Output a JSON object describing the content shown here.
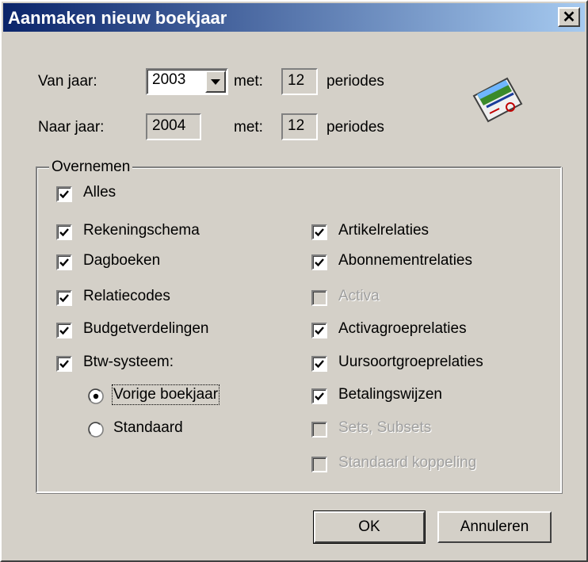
{
  "window": {
    "title": "Aanmaken nieuw boekjaar",
    "close_glyph": "✕"
  },
  "from": {
    "label": "Van jaar:",
    "year": "2003",
    "met_label": "met:",
    "periods": "12",
    "periods_label": "periodes"
  },
  "to": {
    "label": "Naar jaar:",
    "year": "2004",
    "met_label": "met:",
    "periods": "12",
    "periods_label": "periodes"
  },
  "icon": "ledger-book-icon",
  "group": {
    "title": "Overnemen",
    "left": [
      {
        "label": "Alles",
        "checked": true,
        "enabled": true
      },
      {
        "label": "Rekeningschema",
        "checked": true,
        "enabled": true
      },
      {
        "label": "Dagboeken",
        "checked": true,
        "enabled": true
      },
      {
        "label": "Relatiecodes",
        "checked": true,
        "enabled": true
      },
      {
        "label": "Budgetverdelingen",
        "checked": true,
        "enabled": true
      },
      {
        "label": "Btw-systeem:",
        "checked": true,
        "enabled": true
      }
    ],
    "radios": [
      {
        "label": "Vorige boekjaar",
        "selected": true
      },
      {
        "label": "Standaard",
        "selected": false
      }
    ],
    "right": [
      {
        "label": "Artikelrelaties",
        "checked": true,
        "enabled": true
      },
      {
        "label": "Abonnementrelaties",
        "checked": true,
        "enabled": true
      },
      {
        "label": "Activa",
        "checked": false,
        "enabled": false
      },
      {
        "label": "Activagroeprelaties",
        "checked": true,
        "enabled": true
      },
      {
        "label": "Uursoortgroeprelaties",
        "checked": true,
        "enabled": true
      },
      {
        "label": "Betalingswijzen",
        "checked": true,
        "enabled": true
      },
      {
        "label": "Sets, Subsets",
        "checked": false,
        "enabled": false
      },
      {
        "label": "Standaard koppeling",
        "checked": false,
        "enabled": false
      }
    ]
  },
  "buttons": {
    "ok": "OK",
    "cancel": "Annuleren"
  },
  "colors": {
    "title_start": "#0a246a",
    "title_end": "#a6caf0",
    "face": "#d4d0c8",
    "disabled_text": "#a0a0a0"
  }
}
